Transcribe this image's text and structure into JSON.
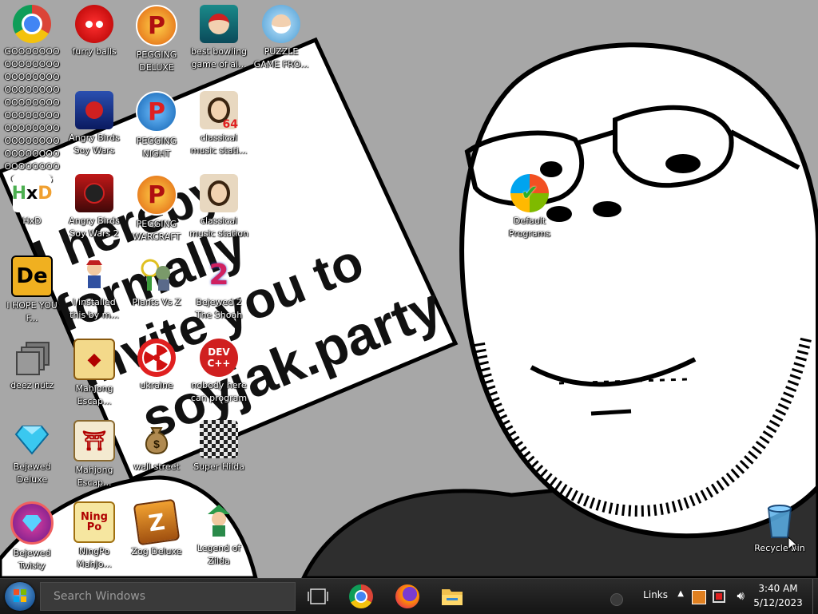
{
  "wallpaper": {
    "sign_text_line1": "I hereby",
    "sign_text_line2": "formally",
    "sign_text_line3": "invite you to",
    "sign_text_line4": "soyjak.party"
  },
  "desktop_icons": [
    {
      "id": "chrome",
      "label": "GOOOOOOOOOOOOOOOOOOOOOOOOOOOOOOOOOOOOOOOOOOOOOOOOOOOOOOOOOOOOOOOOOOOOOOOOOOOOOOOOOOOOG",
      "icon": "chrome-icon"
    },
    {
      "id": "furry-balls",
      "label": "furry balls",
      "icon": "red-fuzzball-icon"
    },
    {
      "id": "pegging-deluxe",
      "label": "PEGGING DELUXE",
      "icon": "peggle-icon"
    },
    {
      "id": "best-bowling",
      "label": "best bowling game of al...",
      "icon": "bowling-santa-icon"
    },
    {
      "id": "puzzle-game",
      "label": "PUZZLE GAME FRO...",
      "icon": "puzzle-old-man-icon"
    },
    {
      "id": "angry-birds-soy-wars",
      "label": "Angry Birds Soy Wars",
      "icon": "angry-birds-star-wars-icon"
    },
    {
      "id": "pegging-night",
      "label": "PEGGING NIGHT",
      "icon": "peggle-night-icon"
    },
    {
      "id": "classical-64",
      "label": "classical music stati...",
      "icon": "portrait-64-icon"
    },
    {
      "id": "hxd",
      "label": "HxD",
      "icon": "hxd-icon"
    },
    {
      "id": "angry-birds-soy-wars-2",
      "label": "Angry Birds Soy Wars 2",
      "icon": "angry-birds-star-wars-2-icon"
    },
    {
      "id": "pegging-warcraft",
      "label": "PEGGING WARCRAFT",
      "icon": "peggle-icon"
    },
    {
      "id": "classical-station",
      "label": "classical music station",
      "icon": "portrait-icon"
    },
    {
      "id": "default-programs",
      "label": "Default Programs",
      "icon": "default-programs-icon"
    },
    {
      "id": "i-hope",
      "label": "I HOPE YOU F...",
      "icon": "de-icon"
    },
    {
      "id": "i-installed",
      "label": "I installed this by m...",
      "icon": "pirate-icon"
    },
    {
      "id": "plants-vs-z",
      "label": "Plants Vs Z",
      "icon": "plants-vs-zombies-icon"
    },
    {
      "id": "bejewed-2",
      "label": "Bejewed 2 The Shoah",
      "icon": "bejeweled-2-icon"
    },
    {
      "id": "deez-nutz",
      "label": "deez nutz",
      "icon": "stacked-windows-icon"
    },
    {
      "id": "mahjong-1",
      "label": "Mahjong Escap...",
      "icon": "mahjong-tile-icon"
    },
    {
      "id": "ukraine",
      "label": "ukraine",
      "icon": "radiation-icon"
    },
    {
      "id": "nobody-here",
      "label": "nobody here can program",
      "icon": "dev-cpp-icon"
    },
    {
      "id": "bejewed-deluxe",
      "label": "Bejewed Deluxe",
      "icon": "diamond-icon"
    },
    {
      "id": "mahjong-2",
      "label": "Mahjong Escap...",
      "icon": "mahjong-torii-icon"
    },
    {
      "id": "wall-street",
      "label": "wall street",
      "icon": "money-bag-icon"
    },
    {
      "id": "super-hilda",
      "label": "Super Hilda",
      "icon": "pixel-character-icon"
    },
    {
      "id": "bejewed-twisty",
      "label": "Bejewed Twisty",
      "icon": "bejeweled-twist-icon"
    },
    {
      "id": "ningpo",
      "label": "NingPo MahJo...",
      "icon": "ningpo-tile-icon"
    },
    {
      "id": "zog-deluxe",
      "label": "Zog Deluxe",
      "icon": "zuma-icon"
    },
    {
      "id": "legend-of-zilda",
      "label": "Legend of Zilda",
      "icon": "zelda-link-icon"
    },
    {
      "id": "recycle-bin",
      "label": "Recycle Bin",
      "icon": "recycle-bin-icon"
    }
  ],
  "taskbar": {
    "search_placeholder": "Search Windows",
    "pinned": [
      {
        "id": "task-view",
        "icon": "task-view-icon"
      },
      {
        "id": "chrome",
        "icon": "chrome-icon"
      },
      {
        "id": "firefox",
        "icon": "firefox-icon"
      },
      {
        "id": "explorer",
        "icon": "folder-icon"
      }
    ],
    "tray": {
      "links_label": "Links",
      "time": "3:40 AM",
      "date": "5/12/2023"
    }
  },
  "colors": {
    "desktop_bg": "#a7a7a7",
    "taskbar_bg": "#1c1c1c",
    "chrome_red": "#db4437",
    "chrome_yellow": "#f4c20d",
    "chrome_green": "#0f9d58",
    "chrome_blue": "#4285f4"
  }
}
